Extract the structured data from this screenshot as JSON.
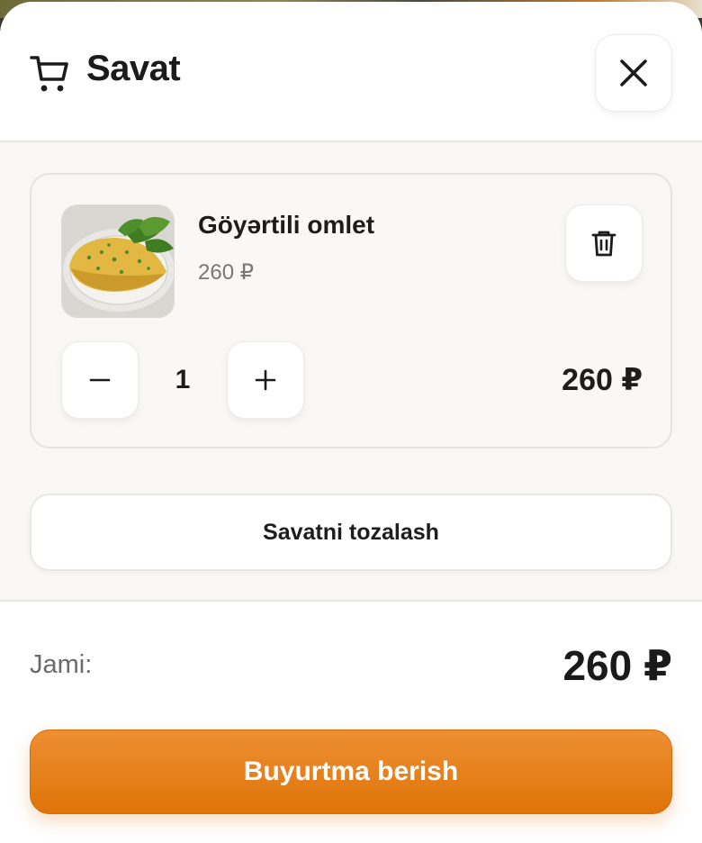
{
  "header": {
    "title": "Savat",
    "cart_icon": "cart-icon",
    "close_icon": "close-icon"
  },
  "cart": {
    "items": [
      {
        "name": "Göyərtili omlet",
        "unit_price": "260 ₽",
        "quantity": "1",
        "line_total": "260 ₽",
        "image_icon": "omelet-plate-image"
      }
    ],
    "clear_label": "Savatni tozalash"
  },
  "footer": {
    "total_label": "Jami:",
    "total_value": "260 ₽",
    "order_label": "Buyurtma berish"
  },
  "colors": {
    "accent": "#df7408",
    "text": "#1d1d1d",
    "muted": "#777777",
    "surface": "#f9f8f6"
  }
}
